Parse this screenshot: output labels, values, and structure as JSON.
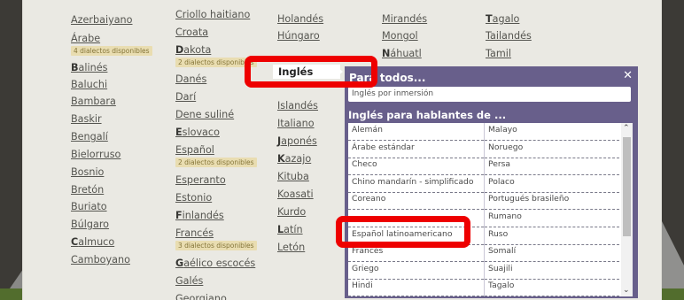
{
  "languages": {
    "col1": [
      {
        "label": "Azerbaiyano"
      },
      {
        "label": "Árabe",
        "badge": "4 dialectos disponibles"
      },
      {
        "label": "Balinés",
        "bold": "B",
        "rest": "alinés"
      },
      {
        "label": "Baluchi"
      },
      {
        "label": "Bambara"
      },
      {
        "label": "Baskir"
      },
      {
        "label": "Bengalí"
      },
      {
        "label": "Bielorruso"
      },
      {
        "label": "Bosnio"
      },
      {
        "label": "Bretón"
      },
      {
        "label": "Buriato"
      },
      {
        "label": "Búlgaro"
      },
      {
        "label": "Calmuco",
        "bold": "C",
        "rest": "almuco"
      },
      {
        "label": "Camboyano"
      }
    ],
    "col2": [
      {
        "label": "Criollo haitiano"
      },
      {
        "label": "Croata"
      },
      {
        "label": "Dakota",
        "bold": "D",
        "rest": "akota",
        "badge": "2 dialectos disponibles"
      },
      {
        "label": "Danés"
      },
      {
        "label": "Darí"
      },
      {
        "label": "Dene suliné"
      },
      {
        "label": "Eslovaco",
        "bold": "E",
        "rest": "slovaco"
      },
      {
        "label": "Español",
        "badge": "2 dialectos disponibles"
      },
      {
        "label": "Esperanto"
      },
      {
        "label": "Estonio"
      },
      {
        "label": "Finlandés",
        "bold": "F",
        "rest": "inlandés"
      },
      {
        "label": "Francés",
        "badge": "3 dialectos disponibles"
      },
      {
        "label": "Gaélico escocés",
        "bold": "G",
        "rest": "aélico escocés"
      },
      {
        "label": "Galés"
      },
      {
        "label": "Georgiano"
      }
    ],
    "col3": [
      {
        "label": "Holandés"
      },
      {
        "label": "Húngaro"
      },
      {
        "label": "Islandés"
      },
      {
        "label": "Italiano"
      },
      {
        "label": "Japonés",
        "bold": "J",
        "rest": "aponés"
      },
      {
        "label": "Kazajo",
        "bold": "K",
        "rest": "azajo"
      },
      {
        "label": "Kituba"
      },
      {
        "label": "Koasati"
      },
      {
        "label": "Kurdo"
      },
      {
        "label": "Latín",
        "bold": "L",
        "rest": "atín"
      },
      {
        "label": "Letón"
      }
    ],
    "col4": [
      {
        "label": "Mirandés"
      },
      {
        "label": "Mongol"
      },
      {
        "label": "Náhuatl",
        "bold": "N",
        "rest": "áhuatl"
      }
    ],
    "col5": [
      {
        "label": "Tagalo",
        "bold": "T",
        "rest": "agalo"
      },
      {
        "label": "Tailandés"
      },
      {
        "label": "Tamil"
      }
    ]
  },
  "tooltip": {
    "label": "Inglés"
  },
  "modal": {
    "title": "Para todos...",
    "close_icon": "close-icon",
    "immersion": "Inglés por inmersión",
    "section_title": "Inglés para hablantes de ...",
    "left_items": [
      "Alemán",
      "Árabe estándar",
      "Checo",
      "Chino mandarín - simplificado",
      "Coreano",
      "",
      "Español latinoamericano",
      "Francés",
      "Griego",
      "Hindi"
    ],
    "right_items": [
      "Malayo",
      "Noruego",
      "Persa",
      "Polaco",
      "Portugués brasileño",
      "Rumano",
      "Ruso",
      "Somalí",
      "Suajili",
      "Tagalo"
    ]
  },
  "colors": {
    "modal_bg": "#685f8b",
    "highlight": "#ee0000",
    "badge_bg": "#f2e6b8"
  }
}
